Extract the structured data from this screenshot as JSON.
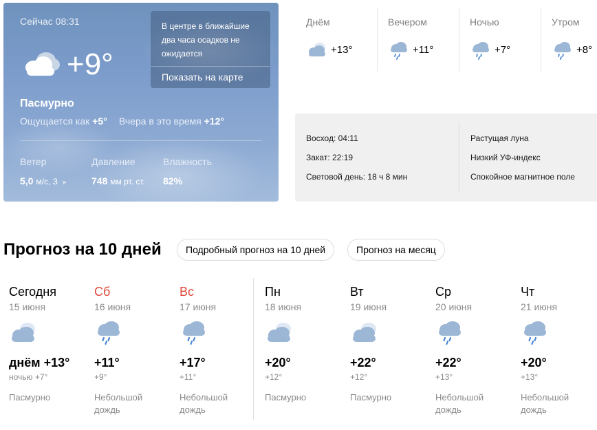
{
  "current": {
    "time": "Сейчас 08:31",
    "temp": "+9°",
    "condition": "Пасмурно",
    "icon": "cloudy-icon",
    "feels_label": "Ощущается как",
    "feels_value": "+5°",
    "yesterday_label": "Вчера в это время",
    "yesterday_value": "+12°",
    "wind_label": "Ветер",
    "wind_value": "5,0",
    "wind_unit": "м/с, З",
    "pressure_label": "Давление",
    "pressure_value": "748",
    "pressure_unit": "мм рт. ст.",
    "humidity_label": "Влажность",
    "humidity_value": "82%",
    "nowcast_text": "В центре в ближайшие два часа осадков не ожидается",
    "nowcast_button": "Показать на карте"
  },
  "day_parts": [
    {
      "label": "Днём",
      "temp": "+13°",
      "icon": "cloudy-icon"
    },
    {
      "label": "Вечером",
      "temp": "+11°",
      "icon": "rain-cloud-icon"
    },
    {
      "label": "Ночью",
      "temp": "+7°",
      "icon": "rain-cloud-icon"
    },
    {
      "label": "Утром",
      "temp": "+8°",
      "icon": "rain-cloud-icon"
    }
  ],
  "astro": {
    "sunrise": "Восход: 04:11",
    "sunset": "Закат: 22:19",
    "daylight": "Световой день: 18 ч 8 мин",
    "moon": "Растущая луна",
    "uv": "Низкий УФ-индекс",
    "magnetic": "Спокойное магнитное поле"
  },
  "forecast": {
    "title": "Прогноз на 10 дней",
    "detailed_button": "Подробный прогноз на 10 дней",
    "month_button": "Прогноз на месяц",
    "days": [
      {
        "name": "Сегодня",
        "date": "15 июня",
        "max": "днём +13°",
        "min": "ночью +7°",
        "condition": "Пасмурно",
        "weekend": false,
        "icon": "cloudy-icon"
      },
      {
        "name": "Сб",
        "date": "16 июня",
        "max": "+11°",
        "min": "+9°",
        "condition": "Небольшой дождь",
        "weekend": true,
        "icon": "rain-cloud-icon"
      },
      {
        "name": "Вс",
        "date": "17 июня",
        "max": "+17°",
        "min": "+11°",
        "condition": "Небольшой дождь",
        "weekend": true,
        "icon": "rain-cloud-icon"
      },
      {
        "name": "Пн",
        "date": "18 июня",
        "max": "+20°",
        "min": "+12°",
        "condition": "Пасмурно",
        "weekend": false,
        "icon": "cloudy-icon"
      },
      {
        "name": "Вт",
        "date": "19 июня",
        "max": "+22°",
        "min": "+12°",
        "condition": "Пасмурно",
        "weekend": false,
        "icon": "cloudy-icon"
      },
      {
        "name": "Ср",
        "date": "20 июня",
        "max": "+22°",
        "min": "+13°",
        "condition": "Небольшой дождь",
        "weekend": false,
        "icon": "rain-cloud-icon"
      },
      {
        "name": "Чт",
        "date": "21 июня",
        "max": "+20°",
        "min": "+13°",
        "condition": "Небольшой дождь",
        "weekend": false,
        "icon": "rain-cloud-icon"
      }
    ]
  },
  "colors": {
    "weekend": "#e14a3d",
    "muted_text": "#8a8a8a",
    "cloud_light": "#dfe8f3",
    "cloud_dark": "#9cb6d6",
    "rain_drop": "#4a86d4"
  }
}
